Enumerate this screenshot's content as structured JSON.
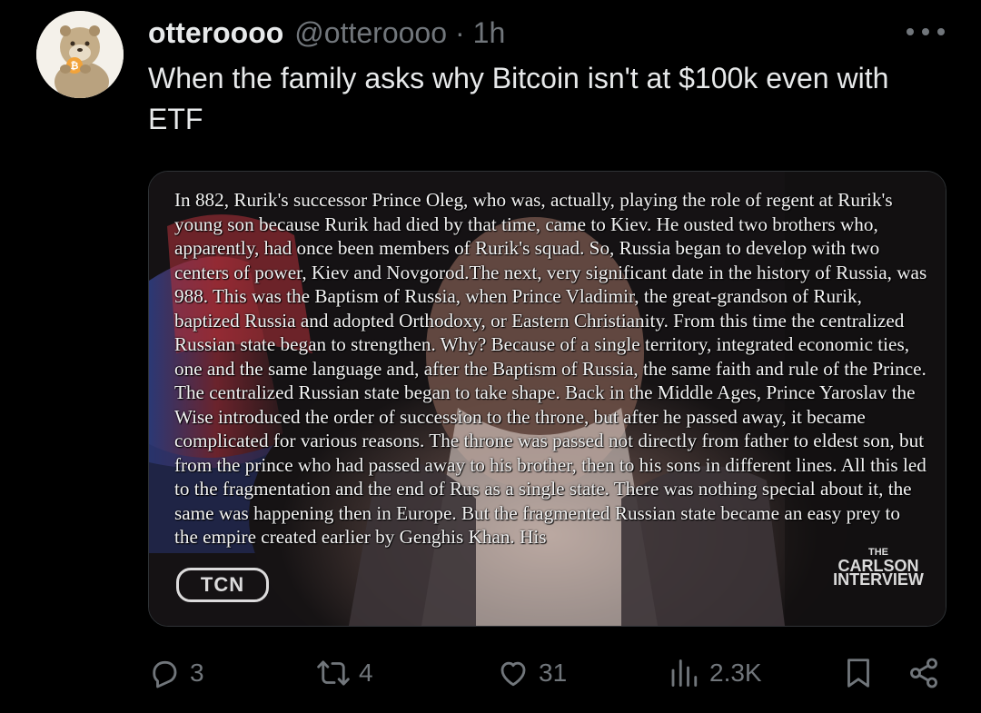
{
  "author": {
    "display_name": "otteroooo",
    "handle": "@otteroooo",
    "separator": "·",
    "time": "1h",
    "avatar_icon": "otter-avatar-icon"
  },
  "post": {
    "text": "When the family asks why Bitcoin isn't at $100k even with ETF"
  },
  "media": {
    "caption": "In 882, Rurik's successor Prince Oleg, who was, actually, playing the role of regent at Rurik's young son because Rurik had died by that time, came to Kiev. He ousted two brothers who, apparently, had once been members of Rurik's squad. So, Russia began to develop with two centers of power, Kiev and Novgorod.The next, very significant date in the history of Russia, was 988. This was the Baptism of Russia, when Prince Vladimir, the great-grandson of Rurik, baptized Russia and adopted Orthodoxy, or Eastern Christianity. From this time the centralized Russian state began to strengthen. Why? Because of a single territory, integrated economic ties, one and the same language and, after the Baptism of Russia, the same faith and rule of the Prince. The centralized Russian state began to take shape. Back in the Middle Ages, Prince Yaroslav the Wise introduced the order of succession to the throne, but after he passed away, it became complicated for various reasons. The throne was passed not directly from father to eldest son, but from the prince who had passed away to his brother, then to his sons in different lines. All this led to the fragmentation and the end of Rus as a single state. There was nothing special about it, the same was happening then in Europe. But the fragmented Russian state became an easy prey to the empire created earlier by Genghis Khan. His",
    "logo_left": "TCN",
    "logo_right_small": "THE",
    "logo_right_line1": "CARLSON",
    "logo_right_line2": "INTERVIEW"
  },
  "actions": {
    "replies": {
      "icon": "reply-icon",
      "count": "3"
    },
    "reposts": {
      "icon": "repost-icon",
      "count": "4"
    },
    "likes": {
      "icon": "heart-icon",
      "count": "31"
    },
    "views": {
      "icon": "views-icon",
      "count": "2.3K"
    },
    "bookmark": {
      "icon": "bookmark-icon"
    },
    "share": {
      "icon": "share-icon"
    }
  },
  "colors": {
    "background": "#000000",
    "text_primary": "#e7e9ea",
    "text_secondary": "#71767b",
    "border": "#2f3336"
  }
}
